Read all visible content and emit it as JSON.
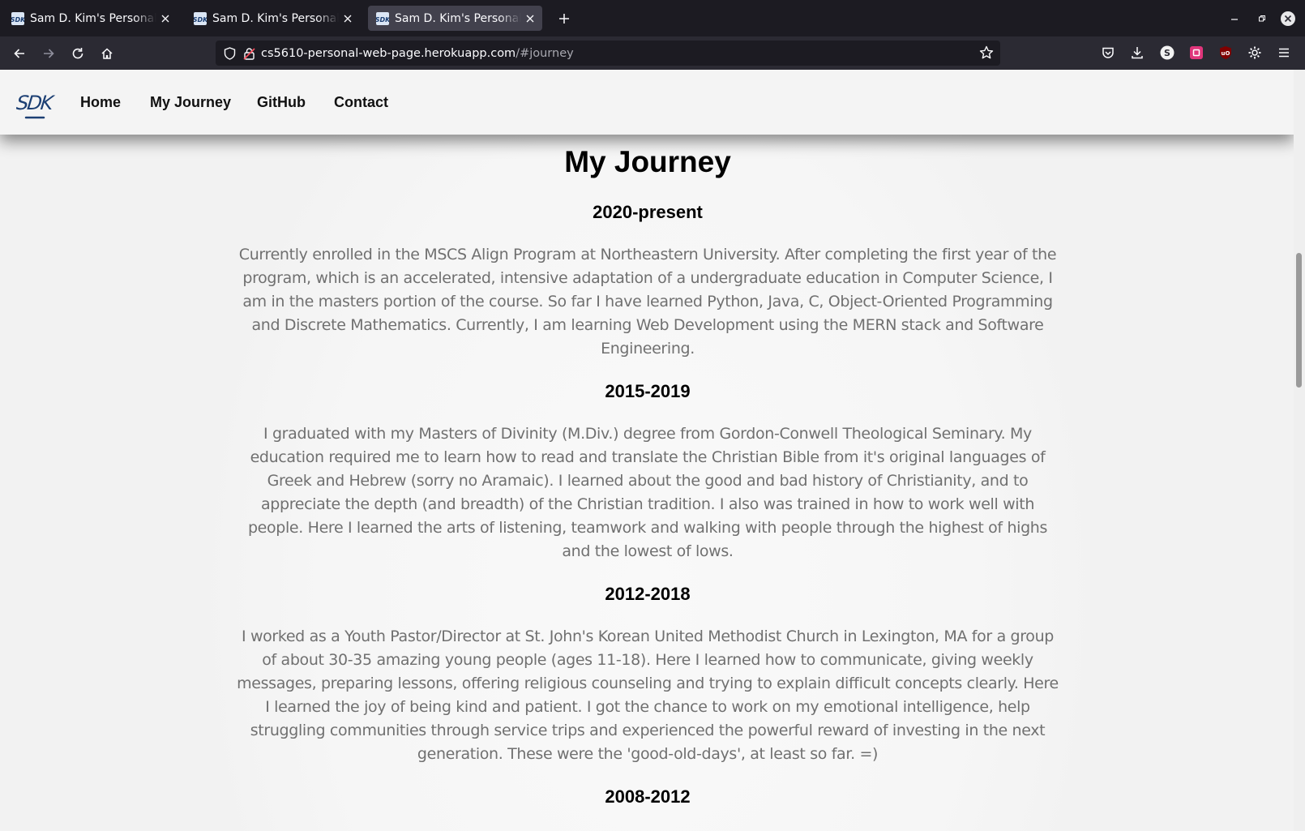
{
  "browser": {
    "tabs": [
      {
        "title": "Sam D. Kim's Personal Web Page",
        "active": false
      },
      {
        "title": "Sam D. Kim's Personal Web Page",
        "active": false
      },
      {
        "title": "Sam D. Kim's Personal Web Page",
        "active": true
      }
    ],
    "url": {
      "host": "cs5610-personal-web-page.herokuapp.com",
      "path": "/#journey"
    },
    "icons": {
      "favicon": "sdk-favicon-icon",
      "close": "close-icon",
      "new_tab": "plus-icon",
      "back": "back-arrow-icon",
      "forward": "forward-arrow-icon",
      "reload": "reload-icon",
      "home": "home-icon",
      "shield": "shield-icon",
      "lock": "lock-icon",
      "bookmark": "star-icon",
      "pocket": "pocket-icon",
      "downloads": "download-icon",
      "extensions": [
        "s-extension-icon",
        "pink-extension-icon",
        "ublock-icon",
        "gear-extension-icon"
      ],
      "menu": "hamburger-menu-icon"
    },
    "colors": {
      "chrome_dark": "#1c1b22",
      "toolbar": "#2b2a33",
      "active_tab": "#42414d"
    }
  },
  "site": {
    "logo_text": "SDK",
    "nav": [
      "Home",
      "My Journey",
      "GitHub",
      "Contact"
    ],
    "colors": {
      "logo": "#1c3f73",
      "body_text": "#707070",
      "heading": "#000000"
    }
  },
  "journey": {
    "title": "My Journey",
    "entries": [
      {
        "period": "2020-present",
        "text": "Currently enrolled in the MSCS Align Program at Northeastern University. After completing the first year of the program, which is an accelerated, intensive adaptation of a undergraduate education in Computer Science, I am in the masters portion of the course. So far I have learned Python, Java, C, Object-Oriented Programming and Discrete Mathematics. Currently, I am learning Web Development using the MERN stack and Software Engineering."
      },
      {
        "period": "2015-2019",
        "text": "I graduated with my Masters of Divinity (M.Div.) degree from Gordon-Conwell Theological Seminary. My education required me to learn how to read and translate the Christian Bible from it's original languages of Greek and Hebrew (sorry no Aramaic). I learned about the good and bad history of Christianity, and to appreciate the depth (and breadth) of the Christian tradition. I also was trained in how to work well with people. Here I learned the arts of listening, teamwork and walking with people through the highest of highs and the lowest of lows."
      },
      {
        "period": "2012-2018",
        "text": "I worked as a Youth Pastor/Director at St. John's Korean United Methodist Church in Lexington, MA for a group of about 30-35 amazing young people (ages 11-18). Here I learned how to communicate, giving weekly messages, preparing lessons, offering religious counseling and trying to explain difficult concepts clearly. Here I learned the joy of being kind and patient. I got the chance to work on my emotional intelligence, help struggling communities through service trips and experienced the powerful reward of investing in the next generation. These were the 'good-old-days', at least so far. =)"
      },
      {
        "period": "2008-2012",
        "text": ""
      }
    ]
  }
}
